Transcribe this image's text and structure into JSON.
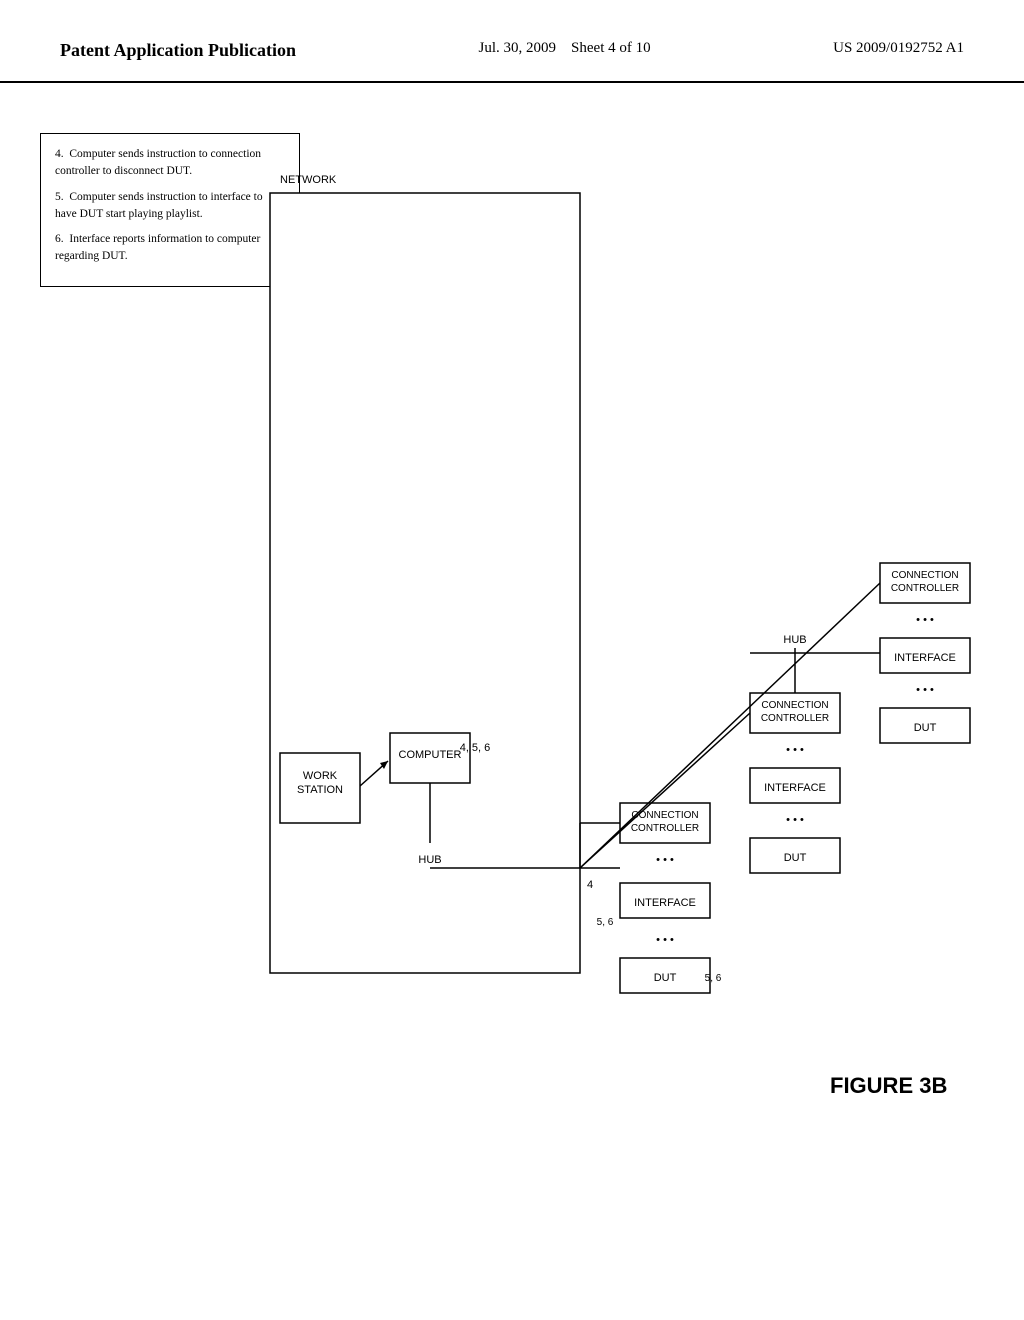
{
  "header": {
    "title": "Patent Application Publication",
    "date": "Jul. 30, 2009",
    "sheet": "Sheet 4 of 10",
    "patent_number": "US 2009/0192752 A1"
  },
  "notes": {
    "items": [
      "4.  Computer sends instruction to connection controller to disconnect DUT.",
      "5.  Computer sends instruction to interface to have DUT start playing playlist.",
      "6.  Interface reports information to computer regarding DUT."
    ]
  },
  "figure_label": "FIGURE 3B",
  "diagram": {
    "network_label": "NETWORK",
    "workstation_label": "WORK\nSTATION",
    "computer_label": "COMPUTER",
    "hub_label_1": "HUB",
    "hub_label_2": "HUB",
    "connection_controller": "CONNECTION\nCONTROLLER",
    "interface": "INTERFACE",
    "dut": "DUT",
    "steps_456": "4, 5, 6",
    "steps_4": "4",
    "steps_56": "5, 6",
    "steps_56b": "5, 6"
  }
}
